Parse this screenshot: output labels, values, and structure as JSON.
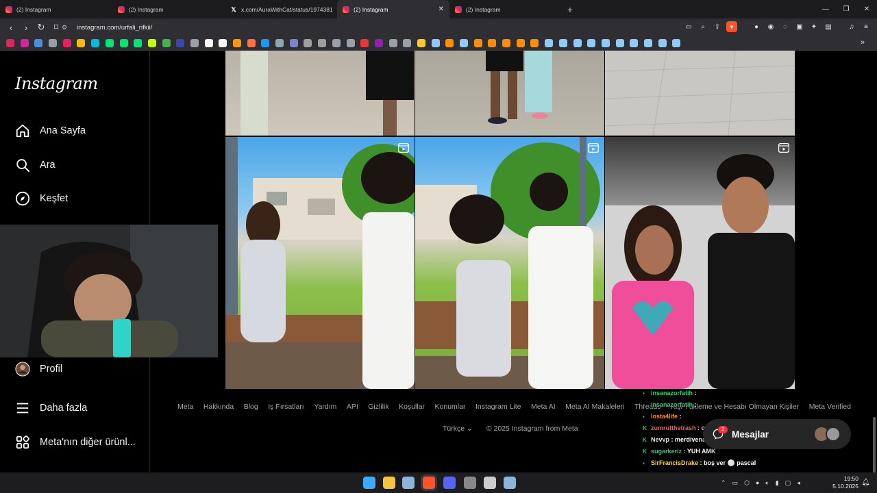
{
  "browser": {
    "tabs": [
      {
        "title": "(2) Instagram",
        "icon": "instagram-icon",
        "active": false
      },
      {
        "title": "(2) Instagram",
        "icon": "instagram-icon",
        "active": false
      },
      {
        "title": "x.com/AuraWithCat/status/1974381",
        "icon": "x-icon",
        "active": false
      },
      {
        "title": "(2) Instagram",
        "icon": "instagram-icon",
        "active": true
      },
      {
        "title": "(2) Instagram",
        "icon": "instagram-icon",
        "active": false
      }
    ],
    "url": "instagram.com/urfali_rifkii/",
    "bookmark_colors": [
      "#e0245e",
      "#d6249f",
      "#4a90e2",
      "#9aa0a6",
      "#e91e63",
      "#fbbc05",
      "#00bcd4",
      "#00e676",
      "#00e676",
      "#00e676",
      "#c6ff00",
      "#4caf50",
      "#3949ab",
      "#9aa0a6",
      "#ffffff",
      "#ffffff",
      "#ff9800",
      "#ff7043",
      "#2196f3",
      "#90a4ae",
      "#7986cb",
      "#9e9e9e",
      "#9e9e9e",
      "#9aa0a6",
      "#9aa0a6",
      "#e53935",
      "#8e24aa",
      "#9aa0a6",
      "#9aa0a6",
      "#ffca28",
      "#90caf9",
      "#ff8f00",
      "#90caf9",
      "#ff8f00",
      "#ff8f00",
      "#ff8f00",
      "#ff8f00",
      "#ff8f00",
      "#90caf9",
      "#90caf9",
      "#90caf9",
      "#90caf9",
      "#90caf9",
      "#90caf9",
      "#90caf9",
      "#90caf9",
      "#90caf9",
      "#90caf9"
    ]
  },
  "instagram": {
    "logo": "Instagram",
    "nav": [
      {
        "label": "Ana Sayfa",
        "icon": "home-icon"
      },
      {
        "label": "Ara",
        "icon": "search-icon"
      },
      {
        "label": "Keşfet",
        "icon": "compass-icon"
      },
      {
        "label": "Profil",
        "icon": "avatar"
      },
      {
        "label": "Daha fazla",
        "icon": "menu-icon"
      },
      {
        "label": "Meta'nın diğer ürünl...",
        "icon": "apps-icon"
      }
    ],
    "footer_links": [
      "Meta",
      "Hakkında",
      "Blog",
      "İş Fırsatları",
      "Yardım",
      "API",
      "Gizlilik",
      "Koşullar",
      "Konumlar",
      "Instagram Lite",
      "Meta AI",
      "Meta AI Makaleleri",
      "Threads",
      "Kişi Yükleme ve Hesabı Olmayan Kişiler",
      "Meta Verified"
    ],
    "language": "Türkçe",
    "copyright": "© 2025 Instagram from Meta",
    "messages": {
      "label": "Mesajlar",
      "badge": "2"
    }
  },
  "chat": [
    {
      "badge": "",
      "user": "insanazorfatih",
      "msg": "",
      "color": "#27d06b"
    },
    {
      "badge": "",
      "user": "insanazorfatih",
      "msg": "",
      "color": "#27d06b"
    },
    {
      "badge": "",
      "user": "losta4life",
      "msg": "",
      "color": "#ff8c1a"
    },
    {
      "badge": "K",
      "user": "zumrutthetrash",
      "msg": "o hareket neydi",
      "color": "#ff5a5a"
    },
    {
      "badge": "K",
      "user": "Nevvp",
      "msg": "merdivenalti nike puma",
      "color": "#e8e8e8"
    },
    {
      "badge": "K",
      "user": "sugarkeriz",
      "msg": "YUH AMK",
      "color": "#27d06b"
    },
    {
      "badge": "",
      "user": "SirFrancisDrake",
      "msg": "boş ver ⚪ pascal",
      "color": "#ffd54a"
    }
  ],
  "taskbar": {
    "time": "19:50",
    "date": "5.10.2025",
    "apps": [
      {
        "name": "windows-start-icon",
        "color": "#3fa9f5"
      },
      {
        "name": "file-explorer-icon",
        "color": "#f4c542"
      },
      {
        "name": "steam-icon",
        "color": "#8fb3d9"
      },
      {
        "name": "brave-icon",
        "color": "#fb542b"
      },
      {
        "name": "discord-icon",
        "color": "#5865f2"
      },
      {
        "name": "obs-icon",
        "color": "#888888"
      },
      {
        "name": "app-icon",
        "color": "#cccccc"
      },
      {
        "name": "steam-icon-2",
        "color": "#8fb3d9"
      }
    ]
  }
}
